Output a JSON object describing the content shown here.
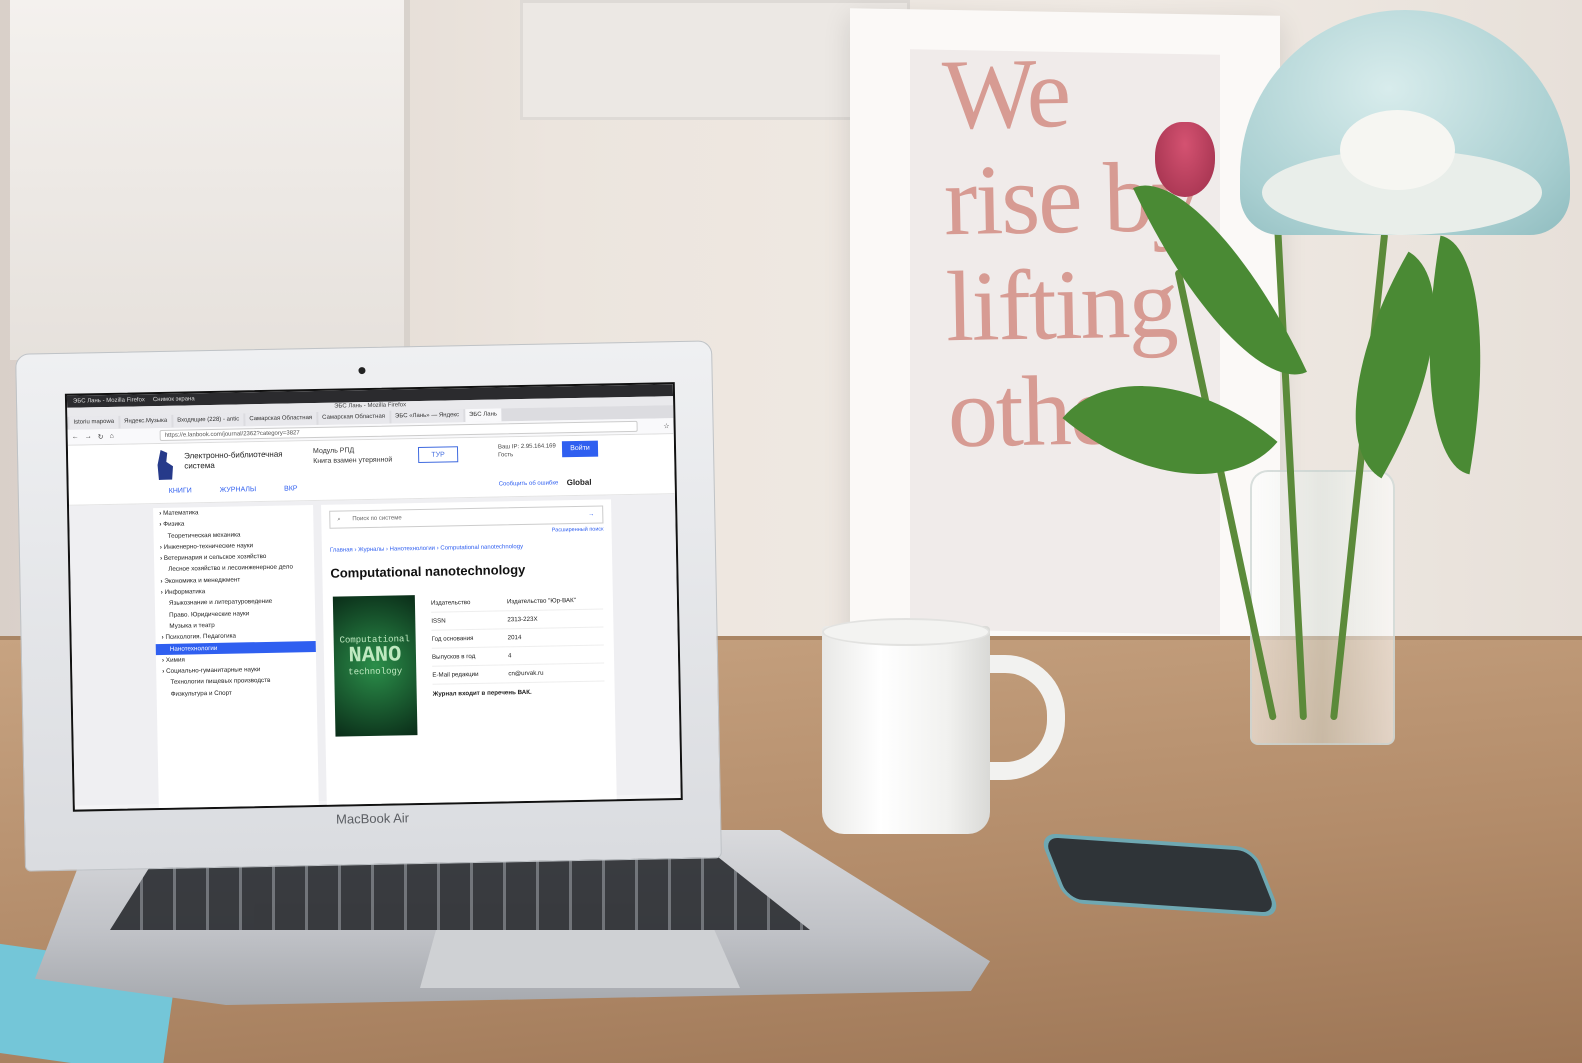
{
  "scene": {
    "poster_lines": [
      "We",
      "rise by",
      "lifting",
      "others."
    ],
    "laptop_brand": "MacBook Air"
  },
  "browser": {
    "os_bar": [
      "ЭБС Лань - Mozilla Firefox",
      "Снимок экрана"
    ],
    "window_title": "ЭБС Лань - Mozilla Firefox",
    "tabs": [
      {
        "label": "Istoriu mapowa",
        "active": false
      },
      {
        "label": "Яндекс.Музыка",
        "active": false
      },
      {
        "label": "Входящие (228) - antic",
        "active": false
      },
      {
        "label": "Самарская Областная",
        "active": false
      },
      {
        "label": "Самарская Областная",
        "active": false
      },
      {
        "label": "ЭБС «Лань» — Яндекс",
        "active": false
      },
      {
        "label": "ЭБС Лань",
        "active": true
      }
    ],
    "url": "https://e.lanbook.com/journal/2362?category=3827"
  },
  "site": {
    "logo_text": "ЛАНЬ",
    "name": "Электронно-библиотечная система",
    "links": [
      "Модуль РПД",
      "Книга взамен утерянной"
    ],
    "tour_label": "ТУР",
    "ip_label": "Ваш IP: 2.95.164.169",
    "guest_label": "Гость",
    "login_label": "Войти",
    "menu": [
      "КНИГИ",
      "ЖУРНАЛЫ",
      "ВКР"
    ],
    "report_label": "Сообщить об ошибке",
    "global_label": "Global"
  },
  "sidebar": {
    "categories": [
      {
        "label": "Математика",
        "expandable": true,
        "selected": false
      },
      {
        "label": "Физика",
        "expandable": true,
        "selected": false
      },
      {
        "label": "Теоретическая механика",
        "expandable": false,
        "selected": false
      },
      {
        "label": "Инженерно-технические науки",
        "expandable": true,
        "selected": false
      },
      {
        "label": "Ветеринария и сельское хозяйство",
        "expandable": true,
        "selected": false
      },
      {
        "label": "Лесное хозяйство и лесоинженерное дело",
        "expandable": false,
        "selected": false
      },
      {
        "label": "Экономика и менеджмент",
        "expandable": true,
        "selected": false
      },
      {
        "label": "Информатика",
        "expandable": true,
        "selected": false
      },
      {
        "label": "Языкознание и литературоведение",
        "expandable": false,
        "selected": false
      },
      {
        "label": "Право. Юридические науки",
        "expandable": false,
        "selected": false
      },
      {
        "label": "Музыка и театр",
        "expandable": false,
        "selected": false
      },
      {
        "label": "Психология. Педагогика",
        "expandable": true,
        "selected": false
      },
      {
        "label": "Нанотехнологии",
        "expandable": false,
        "selected": true
      },
      {
        "label": "Химия",
        "expandable": true,
        "selected": false
      },
      {
        "label": "Социально-гуманитарные науки",
        "expandable": true,
        "selected": false
      },
      {
        "label": "Технологии пищевых производств",
        "expandable": false,
        "selected": false
      },
      {
        "label": "Физкультура и Спорт",
        "expandable": false,
        "selected": false
      }
    ]
  },
  "main": {
    "search_placeholder": "Поиск по системе",
    "advanced_label": "Расширенный поиск",
    "breadcrumb": "Главная › Журналы › Нанотехнологии › Computational nanotechnology",
    "journal_title": "Computational nanotechnology",
    "cover": [
      "Computational",
      "NANO",
      "technology"
    ],
    "info": [
      {
        "key": "Издательство",
        "value": "Издательство \"Юр-ВАК\""
      },
      {
        "key": "ISSN",
        "value": "2313-223X"
      },
      {
        "key": "Год основания",
        "value": "2014"
      },
      {
        "key": "Выпусков в год",
        "value": "4"
      },
      {
        "key": "E-Mail редакции",
        "value": "cn@urvak.ru"
      }
    ],
    "vak_note": "Журнал входит в перечень ВАК."
  }
}
